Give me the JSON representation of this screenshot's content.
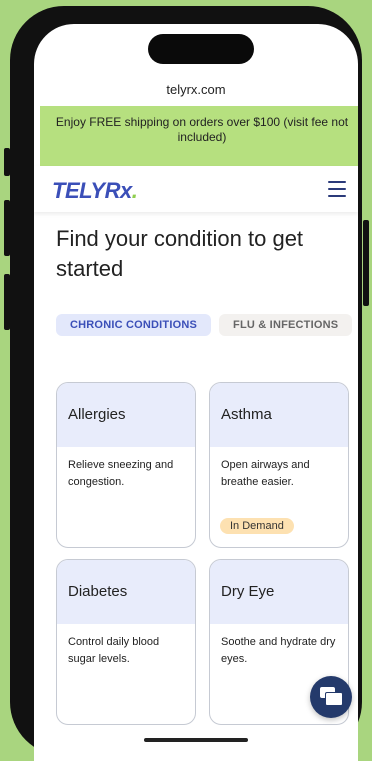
{
  "browser": {
    "url": "telyrx.com"
  },
  "banner": {
    "text": "Enjoy FREE shipping on orders over $100 (visit fee not included)"
  },
  "header": {
    "logo_part1": "TELY",
    "logo_part2": "Rx",
    "logo_dot": "."
  },
  "main": {
    "heading": "Find your condition to get started",
    "tabs": [
      {
        "label": "CHRONIC CONDITIONS",
        "active": true
      },
      {
        "label": "FLU & INFECTIONS",
        "active": false
      }
    ],
    "cards": [
      {
        "title": "Allergies",
        "description": "Relieve sneezing and congestion.",
        "badge": ""
      },
      {
        "title": "Asthma",
        "description": "Open airways and breathe easier.",
        "badge": "In Demand"
      },
      {
        "title": "Diabetes",
        "description": "Control daily blood sugar levels.",
        "badge": ""
      },
      {
        "title": "Dry Eye",
        "description": "Soothe and hydrate dry eyes.",
        "badge": ""
      }
    ]
  },
  "colors": {
    "brand": "#3b4fb8",
    "banner_bg": "#b6e07f",
    "accent": "#8fce4f",
    "chat_bg": "#243a6b"
  },
  "icons": {
    "menu": "hamburger-menu-icon",
    "chat": "chat-bubbles-icon"
  }
}
